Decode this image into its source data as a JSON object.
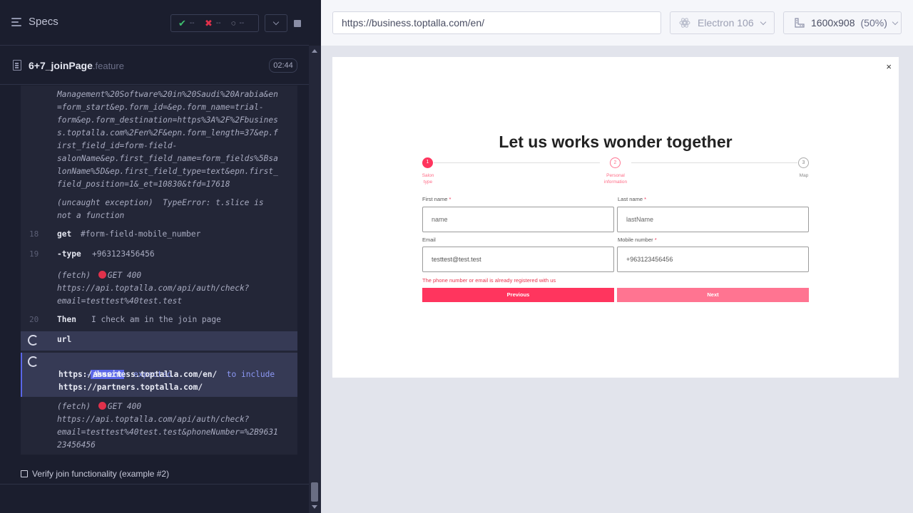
{
  "reporter": {
    "specs_label": "Specs",
    "stats": {
      "passed": "--",
      "failed": "--",
      "pending": "--"
    },
    "spec": {
      "name": "6+7_joinPage",
      "ext": ".feature",
      "duration": "02:44"
    },
    "log": {
      "url_lines": "Management%20Software%20in%20Saudi%20Arabia&en\n=form_start&ep.form_id=&ep.form_name=trial-\nform&ep.form_destination=https%3A%2F%2Fbusines\ns.toptalla.com%2Fen%2F&epn.form_length=37&ep.f\nirst_field_id=form-field-\nsalonName&ep.first_field_name=form_fields%5Bsa\nlonName%5D&ep.first_field_type=text&epn.first_\nfield_position=1&_et=10830&tfd=17618",
      "exception": "(uncaught exception)  TypeError: t.slice is\nnot a function",
      "line18": "18",
      "cmd18": "get",
      "arg18": "#form-field-mobile_number",
      "line19": "19",
      "cmd19": "-type",
      "arg19": "+963123456456",
      "fetch1_prefix": "(fetch)",
      "fetch1_method": "GET 400",
      "fetch1_url": "https://api.toptalla.com/api/auth/check?\nemail=testtest%40test.test",
      "line20": "20",
      "cmd20": "Then",
      "arg20": "I check am in the join page",
      "url_cmd": "url",
      "assert_dash": "-",
      "assert_label": "assert",
      "assert_expected": "expected",
      "assert_actual": "https://business.toptalla.com/en/",
      "assert_include": "to include",
      "assert_target": "https://partners.toptalla.com/",
      "fetch2_prefix": "(fetch)",
      "fetch2_method": "GET 400",
      "fetch2_url": "https://api.toptalla.com/api/auth/check?\nemail=testtest%40test.test&phoneNumber=%2B9631\n23456456"
    },
    "next_test": "Verify join functionality (example #2)"
  },
  "aut": {
    "url": "https://business.toptalla.com/en/",
    "browser": "Electron 106",
    "viewport": "1600x908",
    "zoom": "(50%)",
    "page": {
      "close": "×",
      "title": "Let us works wonder together",
      "steps": [
        {
          "num": "1",
          "label": "Salon\ntype"
        },
        {
          "num": "2",
          "label": "Personal\ninformation"
        },
        {
          "num": "3",
          "label": "Map"
        }
      ],
      "first_name_label": "First name",
      "first_name_placeholder": "name",
      "last_name_label": "Last name",
      "last_name_placeholder": "lastName",
      "email_label": "Email",
      "email_value": "testtest@test.test",
      "mobile_label": "Mobile number",
      "mobile_value": "+963123456456",
      "required_mark": "*",
      "error": "The phone number or email is already registered with us",
      "prev_btn": "Previous",
      "next_btn": "Next"
    },
    "colors": {
      "accent": "#ff355e",
      "accent_light": "#ff7491"
    }
  }
}
